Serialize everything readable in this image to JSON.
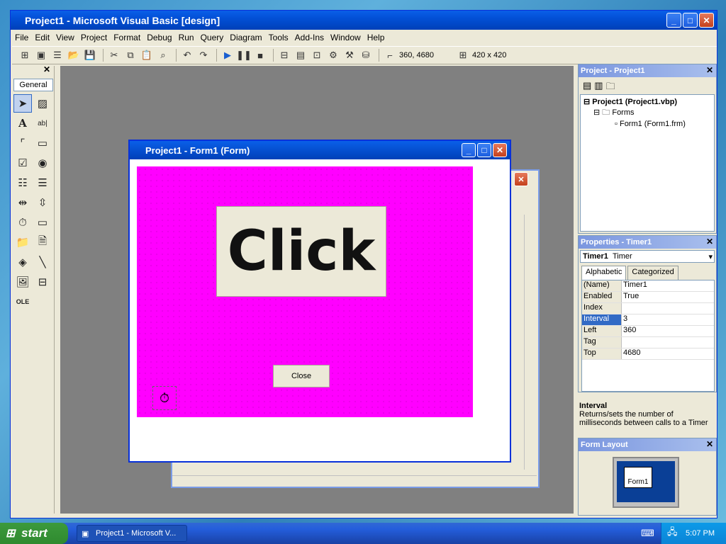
{
  "window": {
    "title": "Project1 - Microsoft Visual Basic [design]"
  },
  "menu": [
    "File",
    "Edit",
    "View",
    "Project",
    "Format",
    "Debug",
    "Run",
    "Query",
    "Diagram",
    "Tools",
    "Add-Ins",
    "Window",
    "Help"
  ],
  "toolbar": {
    "position": "360, 4680",
    "size": "420 x 420"
  },
  "toolbox": {
    "tab": "General",
    "tools": [
      "pointer-icon",
      "picturebox-icon",
      "label-icon",
      "textbox-icon",
      "frame-icon",
      "commandbutton-icon",
      "checkbox-icon",
      "optionbutton-icon",
      "combobox-icon",
      "listbox-icon",
      "hscrollbar-icon",
      "vscrollbar-icon",
      "timer-icon",
      "drivelistbox-icon",
      "dirlistbox-icon",
      "filelistbox-icon",
      "shape-icon",
      "line-icon",
      "image-icon",
      "data-icon",
      "ole-icon"
    ]
  },
  "form": {
    "title": "Project1 - Form1 (Form)",
    "click_label": "Click",
    "close_label": "Close"
  },
  "project": {
    "title": "Project - Project1",
    "root": "Project1 (Project1.vbp)",
    "folder": "Forms",
    "item": "Form1 (Form1.frm)"
  },
  "properties": {
    "title": "Properties - Timer1",
    "object": "Timer1",
    "object_type": "Timer",
    "tab_alpha": "Alphabetic",
    "tab_cat": "Categorized",
    "rows": [
      [
        "(Name)",
        "Timer1"
      ],
      [
        "Enabled",
        "True"
      ],
      [
        "Index",
        ""
      ],
      [
        "Interval",
        "3"
      ],
      [
        "Left",
        "360"
      ],
      [
        "Tag",
        ""
      ],
      [
        "Top",
        "4680"
      ]
    ]
  },
  "description": {
    "title": "Interval",
    "text": "Returns/sets the number of milliseconds between calls to a Timer"
  },
  "layout": {
    "title": "Form Layout",
    "form": "Form1"
  },
  "taskbar": {
    "start": "start",
    "item": "Project1 - Microsoft V...",
    "clock": "5:07 PM"
  }
}
